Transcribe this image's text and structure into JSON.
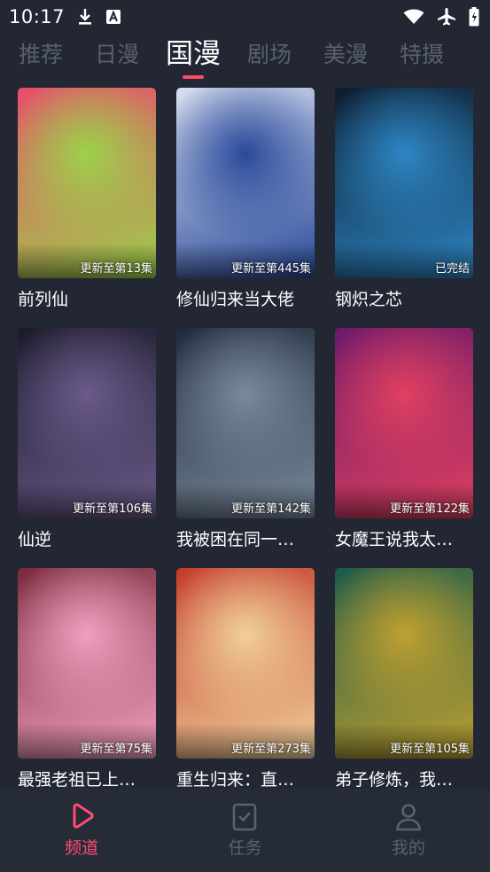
{
  "status_bar": {
    "time": "10:17",
    "left_icons": [
      "download-icon",
      "app-notification-icon"
    ],
    "right_icons": [
      "wifi-icon",
      "airplane-icon",
      "battery-icon"
    ]
  },
  "tabs": [
    {
      "label": "推荐",
      "active": false
    },
    {
      "label": "日漫",
      "active": false
    },
    {
      "label": "国漫",
      "active": true
    },
    {
      "label": "剧场",
      "active": false
    },
    {
      "label": "美漫",
      "active": false
    },
    {
      "label": "特摄",
      "active": false
    }
  ],
  "accent_color": "#ff4d6d",
  "comics": [
    {
      "title": "前列仙",
      "badge": "更新至第13集",
      "colors": [
        "#e94b6b",
        "#9bd24a"
      ]
    },
    {
      "title": "修仙归来当大佬",
      "badge": "更新至第445集",
      "colors": [
        "#d9dff0",
        "#2a4a9a"
      ]
    },
    {
      "title": "钢炽之芯",
      "badge": "已完结",
      "colors": [
        "#0d1a2a",
        "#2d86c4"
      ]
    },
    {
      "title": "仙逆",
      "badge": "更新至第106集",
      "colors": [
        "#1b1a2a",
        "#6a5a8a"
      ]
    },
    {
      "title": "我被困在同一…",
      "badge": "更新至第142集",
      "colors": [
        "#1f2b3d",
        "#7a8a9a"
      ]
    },
    {
      "title": "女魔王说我太…",
      "badge": "更新至第122集",
      "colors": [
        "#6a1a6a",
        "#e04060"
      ]
    },
    {
      "title": "最强老祖已上…",
      "badge": "更新至第75集",
      "colors": [
        "#7a2a3a",
        "#f0a0c0"
      ]
    },
    {
      "title": "重生归来：直…",
      "badge": "更新至第273集",
      "colors": [
        "#c43a2a",
        "#f0d09a"
      ]
    },
    {
      "title": "弟子修炼，我…",
      "badge": "更新至第105集",
      "colors": [
        "#1a5a4a",
        "#c0a030"
      ]
    }
  ],
  "bottom_nav": [
    {
      "label": "频道",
      "icon": "play-icon",
      "active": true
    },
    {
      "label": "任务",
      "icon": "task-icon",
      "active": false
    },
    {
      "label": "我的",
      "icon": "profile-icon",
      "active": false
    }
  ]
}
